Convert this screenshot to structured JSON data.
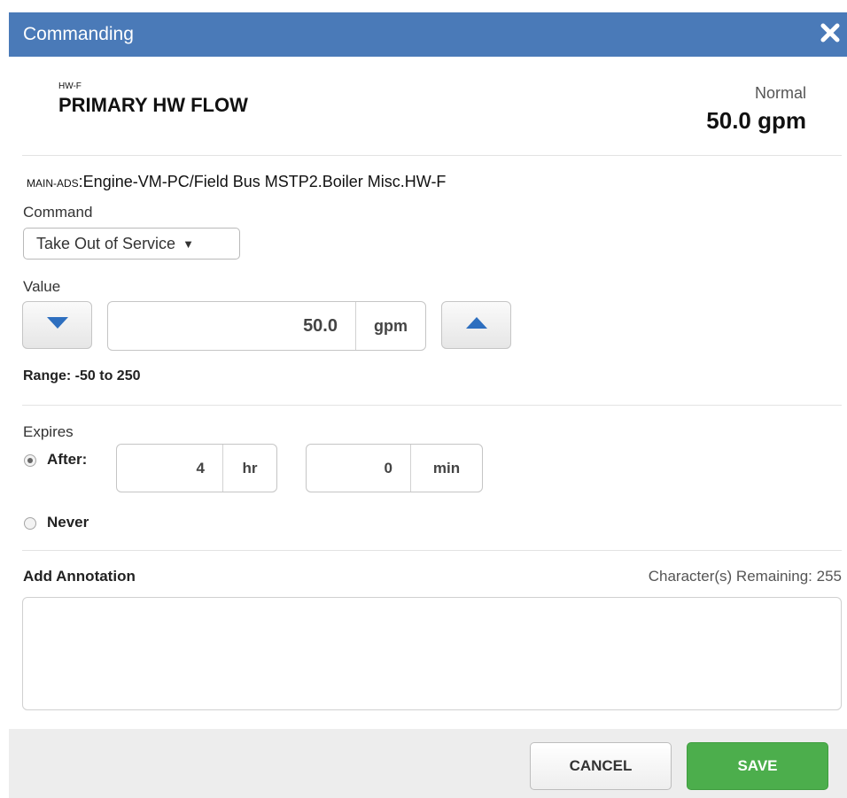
{
  "dialog": {
    "title": "Commanding"
  },
  "object": {
    "short_name": "HW-F",
    "name": "PRIMARY HW FLOW",
    "status": "Normal",
    "present_value": "50.0 gpm"
  },
  "path": {
    "prefix": "MAIN-ADS",
    "value": ":Engine-VM-PC/Field Bus MSTP2.Boiler Misc.HW-F"
  },
  "command": {
    "label": "Command",
    "selected": "Take Out of Service"
  },
  "value": {
    "label": "Value",
    "amount": "50.0",
    "unit": "gpm",
    "range_text": "Range: -50 to 250"
  },
  "expires": {
    "label": "Expires",
    "after_label": "After:",
    "hours": "4",
    "hours_unit": "hr",
    "minutes": "0",
    "minutes_unit": "min",
    "never_label": "Never",
    "selected": "after"
  },
  "annotation": {
    "label": "Add Annotation",
    "remaining": "Character(s) Remaining: 255",
    "text": ""
  },
  "footer": {
    "cancel_label": "CANCEL",
    "save_label": "SAVE"
  },
  "colors": {
    "titlebar": "#4a7ab8",
    "arrow_icons": "#2e6fbf",
    "save_button": "#4cae4c"
  }
}
